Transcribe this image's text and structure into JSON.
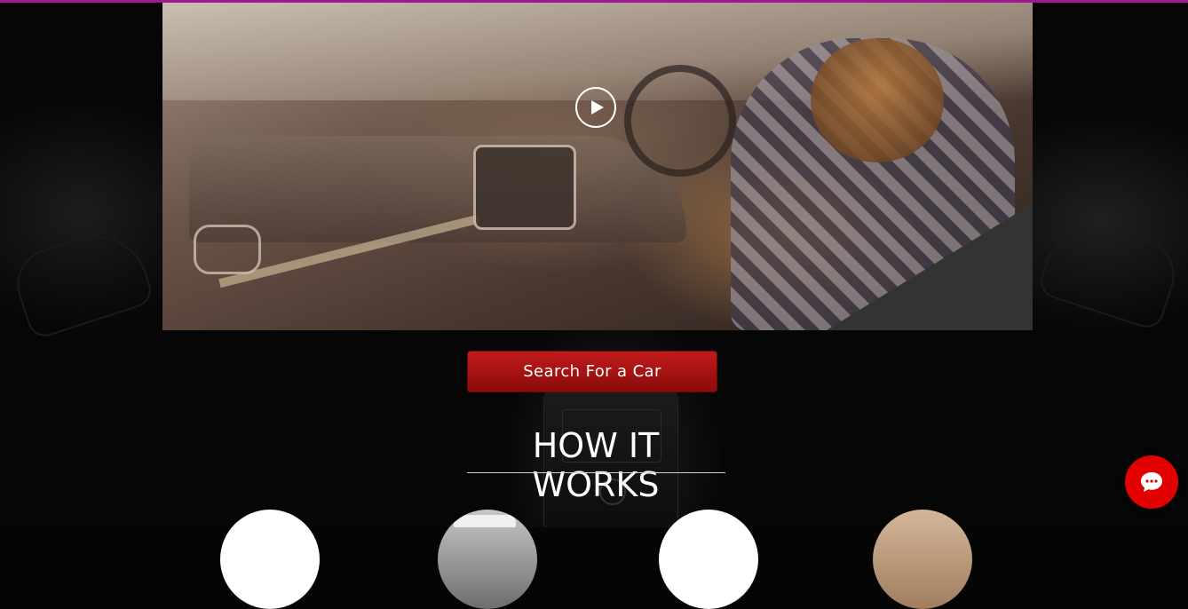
{
  "colors": {
    "top_bar": "#a0178f",
    "button_red": "#b31414",
    "chat_red": "#e30000",
    "heading": "#ffffff"
  },
  "video": {
    "play_icon": "play-icon"
  },
  "search_button": {
    "label": "Search For a Car"
  },
  "section": {
    "title": "HOW IT WORKS"
  },
  "steps": [
    {
      "icon": "step-1-image"
    },
    {
      "icon": "step-2-image"
    },
    {
      "icon": "step-3-image"
    },
    {
      "icon": "step-4-image"
    }
  ],
  "chat_widget": {
    "icon": "chat-bubble-icon"
  }
}
